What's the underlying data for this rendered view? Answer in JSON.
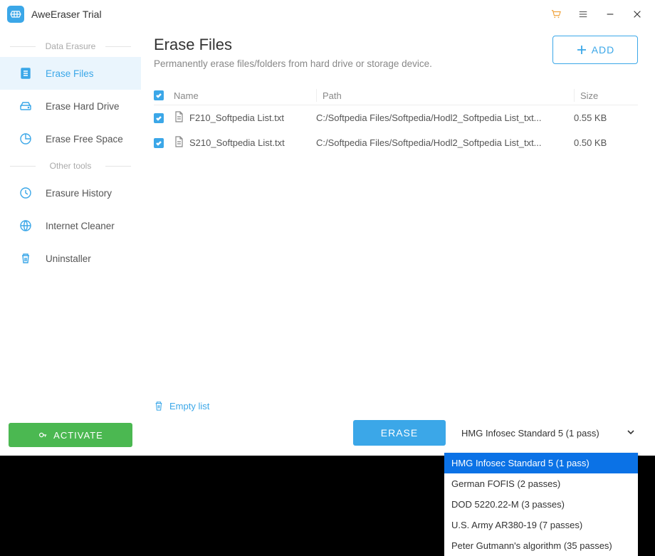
{
  "app": {
    "title": "AweEraser Trial"
  },
  "sidebar": {
    "groups": {
      "erase": "Data Erasure",
      "other": "Other tools"
    },
    "items": {
      "erase_files": "Erase Files",
      "erase_hard_drive": "Erase Hard Drive",
      "erase_free_space": "Erase Free Space",
      "erasure_history": "Erasure History",
      "internet_cleaner": "Internet Cleaner",
      "uninstaller": "Uninstaller"
    },
    "activate": "ACTIVATE"
  },
  "main": {
    "title": "Erase Files",
    "subtitle": "Permanently erase files/folders from hard drive or storage device.",
    "add": "ADD",
    "empty": "Empty list",
    "erase": "ERASE",
    "columns": {
      "name": "Name",
      "path": "Path",
      "size": "Size"
    }
  },
  "files": [
    {
      "name": "F210_Softpedia List.txt",
      "path": "C:/Softpedia Files/Softpedia/Hodl2_Softpedia List_txt...",
      "size": "0.55 KB"
    },
    {
      "name": "S210_Softpedia List.txt",
      "path": "C:/Softpedia Files/Softpedia/Hodl2_Softpedia List_txt...",
      "size": "0.50 KB"
    }
  ],
  "algorithms": {
    "selected": "HMG Infosec Standard 5 (1 pass)",
    "options": [
      "HMG Infosec Standard 5 (1 pass)",
      "German FOFIS (2 passes)",
      "DOD 5220.22-M (3 passes)",
      "U.S. Army AR380-19 (7 passes)",
      "Peter Gutmann's algorithm (35 passes)"
    ]
  }
}
